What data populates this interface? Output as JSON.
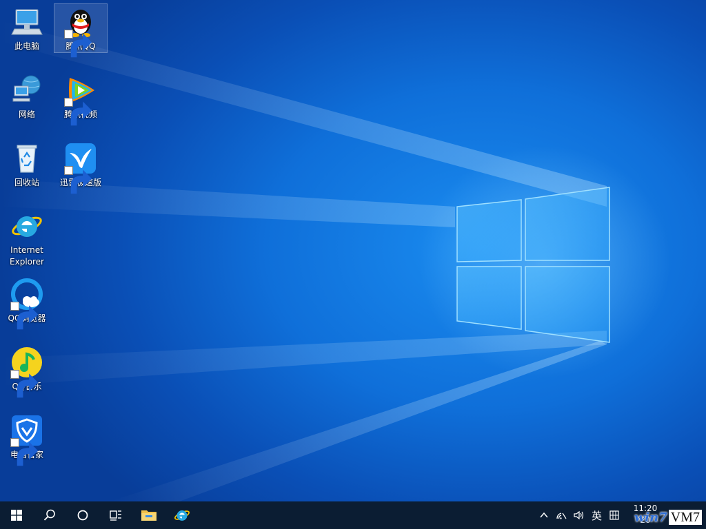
{
  "desktop": {
    "icons": [
      {
        "label": "此电脑",
        "icon": "computer-icon"
      },
      {
        "label": "腾讯QQ",
        "icon": "qq-penguin-icon"
      },
      {
        "label": "网络",
        "icon": "network-icon"
      },
      {
        "label": "腾讯视频",
        "icon": "tencent-video-icon"
      },
      {
        "label": "回收站",
        "icon": "recycle-bin-icon"
      },
      {
        "label": "迅雷极速版",
        "icon": "xunlei-bird-icon"
      },
      {
        "label": "Internet Explorer",
        "icon": "internet-explorer-icon"
      },
      {
        "label": "QQ浏览器",
        "icon": "qq-browser-icon"
      },
      {
        "label": "QQ音乐",
        "icon": "qq-music-icon"
      },
      {
        "label": "电脑管家",
        "icon": "pc-manager-shield-icon"
      }
    ]
  },
  "taskbar": {
    "pinned": [
      "windows-start-icon",
      "search-icon",
      "cortana-circle-icon",
      "task-view-icon",
      "file-explorer-folder-icon",
      "internet-explorer-icon"
    ],
    "tray": {
      "ime_label": "英",
      "time": "11:20",
      "date": "20"
    }
  },
  "watermark": {
    "text1": "win7",
    "text2": "VM7"
  },
  "colors": {
    "taskbar_bg": "#0b1d33",
    "wallpaper_blue": "#0f6fd9",
    "logo_glow": "#7fd3ff"
  }
}
